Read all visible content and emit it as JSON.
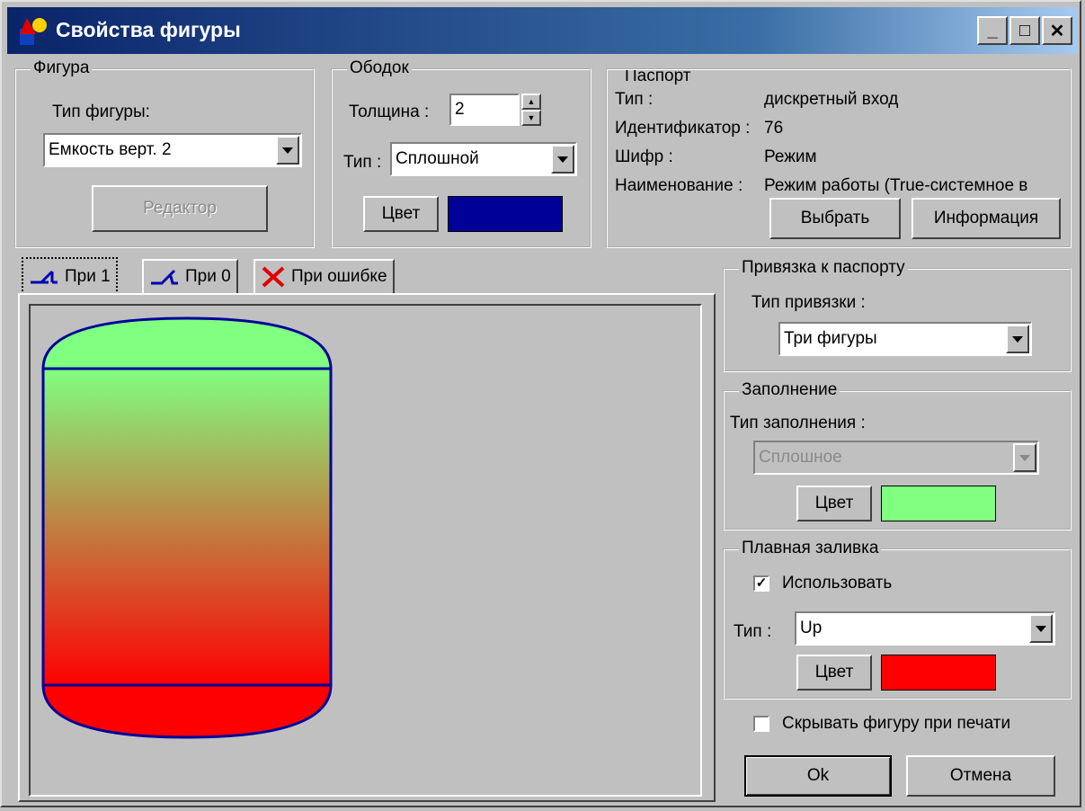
{
  "window": {
    "title": "Свойства фигуры",
    "minimize": "_",
    "maximize": "□",
    "close": "✕"
  },
  "figure_group": {
    "title": "Фигура",
    "type_label": "Тип фигуры:",
    "type_value": "Емкость верт. 2",
    "editor_button": "Редактор"
  },
  "border_group": {
    "title": "Ободок",
    "thickness_label": "Толщина :",
    "thickness_value": "2",
    "type_label": "Тип :",
    "type_value": "Сплошной",
    "color_button": "Цвет",
    "color": "#000099"
  },
  "passport_group": {
    "title": "Паспорт",
    "rows": [
      {
        "label": "Тип :",
        "value": "дискретный вход"
      },
      {
        "label": "Идентификатор :",
        "value": "76"
      },
      {
        "label": "Шифр :",
        "value": "Режим"
      },
      {
        "label": "Наименование :",
        "value": "Режим работы (True-системное в"
      }
    ],
    "select_button": "Выбрать",
    "info_button": "Информация"
  },
  "tabs": [
    {
      "label": "При 1",
      "icon": "switch-on-icon",
      "active": true
    },
    {
      "label": "При 0",
      "icon": "switch-off-icon",
      "active": false
    },
    {
      "label": "При ошибке",
      "icon": "red-x-icon",
      "active": false
    }
  ],
  "binding_group": {
    "title": "Привязка к паспорту",
    "type_label": "Тип привязки :",
    "type_value": "Три фигуры"
  },
  "fill_group": {
    "title": "Заполнение",
    "type_label": "Тип заполнения :",
    "type_value": "Сплошное",
    "color_button": "Цвет",
    "color": "#80ff80"
  },
  "gradient_group": {
    "title": "Плавная заливка",
    "use_label": "Использовать",
    "use_checked": true,
    "type_label": "Тип :",
    "type_value": "Up",
    "color_button": "Цвет",
    "color": "#ff0000"
  },
  "hide_print": {
    "label": "Скрывать фигуру при печати",
    "checked": false
  },
  "ok_button": "Ok",
  "cancel_button": "Отмена"
}
